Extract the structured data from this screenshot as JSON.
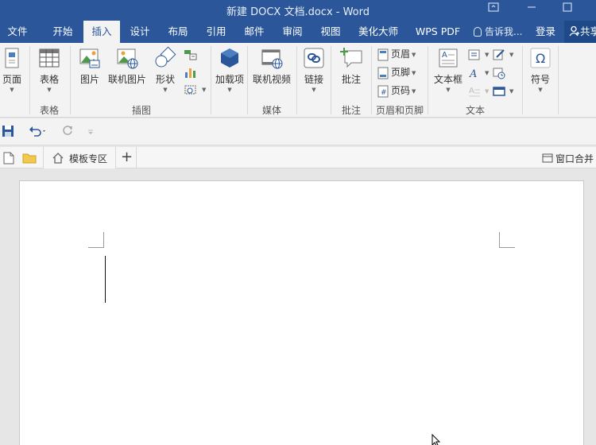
{
  "window": {
    "title": "新建 DOCX 文档.docx - Word"
  },
  "tabs": [
    {
      "label": "文件"
    },
    {
      "label": "开始"
    },
    {
      "label": "插入",
      "active": true
    },
    {
      "label": "设计"
    },
    {
      "label": "布局"
    },
    {
      "label": "引用"
    },
    {
      "label": "邮件"
    },
    {
      "label": "审阅"
    },
    {
      "label": "视图"
    },
    {
      "label": "美化大师"
    },
    {
      "label": "WPS PDF"
    }
  ],
  "tell_me": "告诉我...",
  "login": "登录",
  "share": "共享",
  "ribbon": {
    "page_btn": "页面",
    "table_btn": "表格",
    "table_group": "表格",
    "picture_btn": "图片",
    "online_picture_btn": "联机图片",
    "shapes_btn": "形状",
    "illustrations_group": "插图",
    "addins_btn": "加载项",
    "online_video_btn": "联机视频",
    "media_group": "媒体",
    "link_btn": "链接",
    "comment_btn": "批注",
    "comments_group": "批注",
    "header_btn": "页眉",
    "footer_btn": "页脚",
    "page_number_btn": "页码",
    "header_footer_group": "页眉和页脚",
    "textbox_btn": "文本框",
    "text_group": "文本",
    "symbol_btn": "符号",
    "symbol_glyph": "Ω"
  },
  "wps_bar": {
    "template_tab": "模板专区",
    "add_tab": "+",
    "merge_windows": "窗口合并"
  },
  "colors": {
    "brand_blue": "#2b579a",
    "ribbon_bg": "#f3f3f3"
  }
}
